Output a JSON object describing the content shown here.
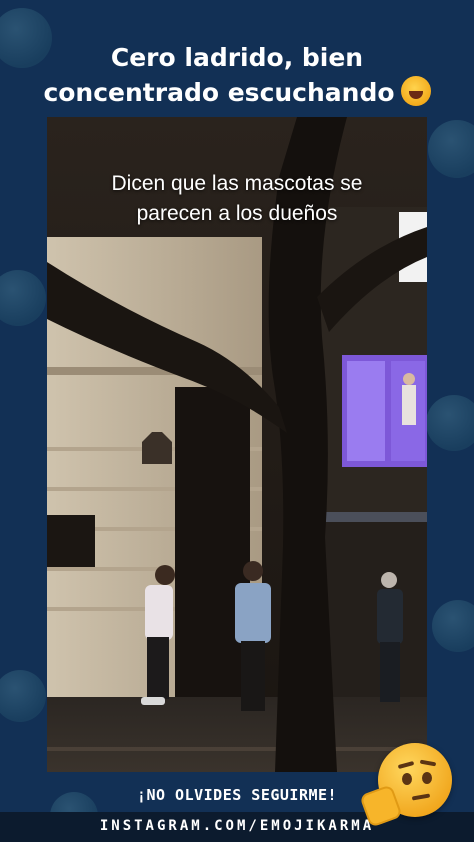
{
  "header": {
    "line1": "Cero ladrido, bien",
    "line2": "concentrado escuchando"
  },
  "video": {
    "caption_line1": "Dicen que las mascotas se",
    "caption_line2": "parecen a los dueños"
  },
  "footer": {
    "cta": "¡NO OLVIDES SEGUIRME!",
    "handle": "INSTAGRAM.COM/EMOJIKARMA"
  },
  "icons": {
    "header_emoji": "rolling-on-floor-laughing-icon",
    "corner_emoji": "thinking-face-icon",
    "background_emoji": "money-face-icon"
  },
  "colors": {
    "background": "#123055",
    "footer_bar": "#0c1b2e",
    "text": "#ffffff"
  }
}
